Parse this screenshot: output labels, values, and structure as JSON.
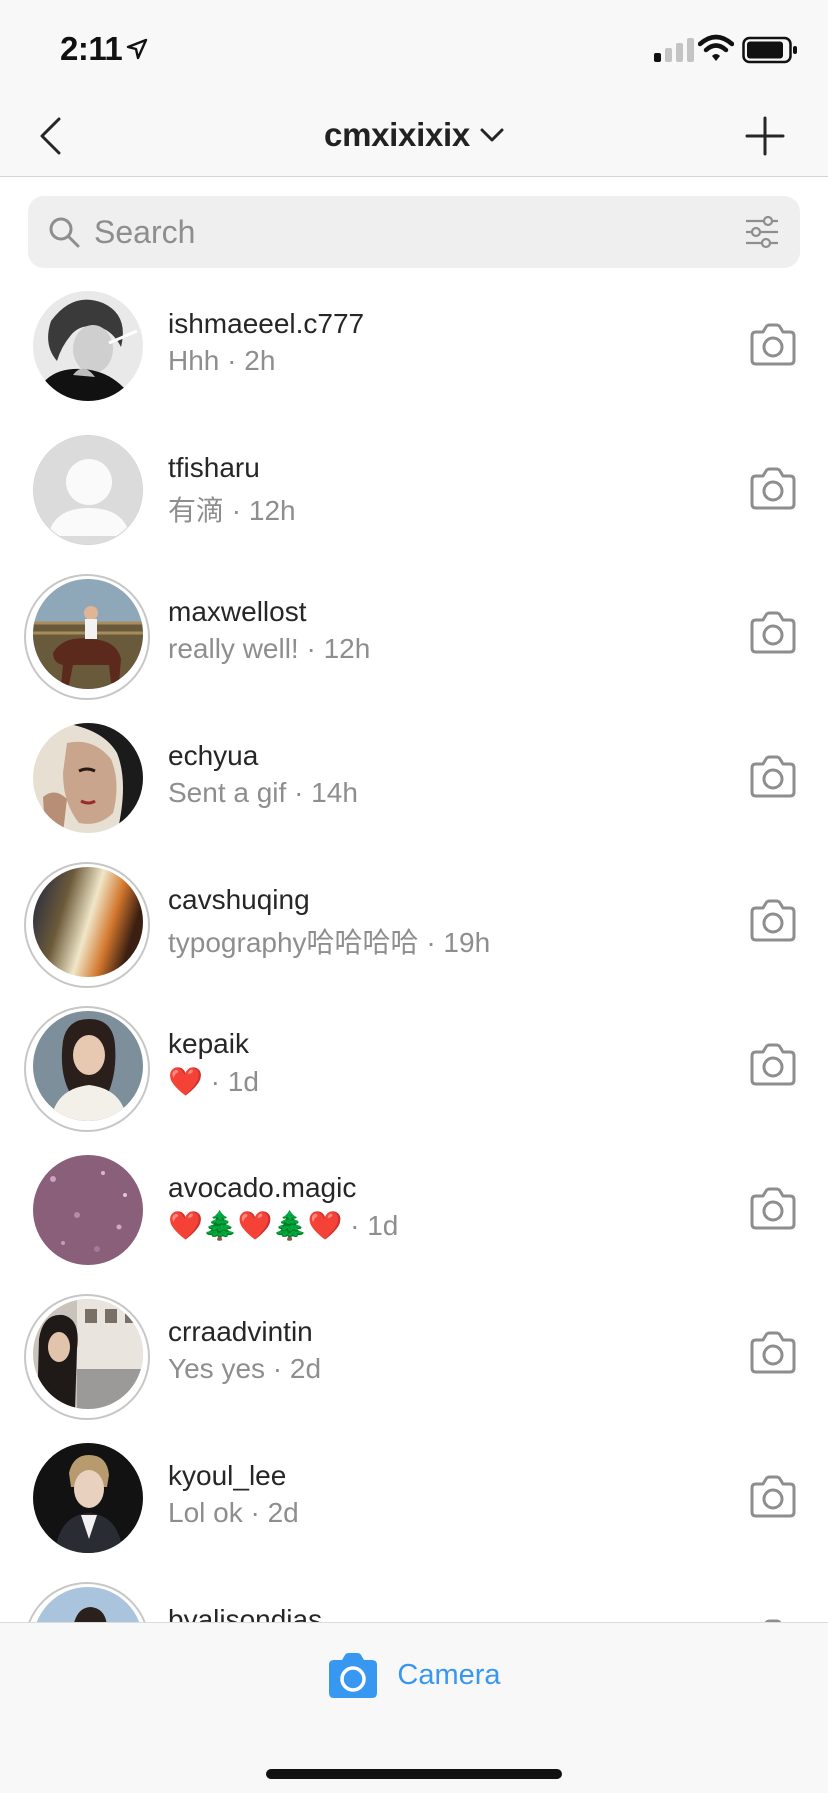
{
  "status_bar": {
    "time": "2:11"
  },
  "header": {
    "title": "cmxixixix"
  },
  "search": {
    "placeholder": "Search"
  },
  "threads": [
    {
      "username": "ishmaeeel.c777",
      "preview": "Hhh · 2h",
      "ring": false,
      "avatar": "bw-portrait"
    },
    {
      "username": "tfisharu",
      "preview": "有滴 · 12h",
      "ring": false,
      "avatar": "default-avatar"
    },
    {
      "username": "maxwellost",
      "preview": "really well! · 12h",
      "ring": true,
      "avatar": "horse-rider-photo"
    },
    {
      "username": "echyua",
      "preview": "Sent a gif · 14h",
      "ring": false,
      "avatar": "illustrated-woman"
    },
    {
      "username": "cavshuqing",
      "preview": "typography哈哈哈哈 · 19h",
      "ring": true,
      "avatar": "light-leak-photo"
    },
    {
      "username": "kepaik",
      "preview": "❤️ · 1d",
      "ring": true,
      "avatar": "woman-portrait"
    },
    {
      "username": "avocado.magic",
      "preview": "❤️🌲❤️🌲❤️ · 1d",
      "ring": false,
      "avatar": "purple-glitter"
    },
    {
      "username": "crraadvintin",
      "preview": "Yes yes · 2d",
      "ring": true,
      "avatar": "street-portrait"
    },
    {
      "username": "kyoul_lee",
      "preview": "Lol ok · 2d",
      "ring": false,
      "avatar": "man-portrait"
    },
    {
      "username": "byalisondias",
      "preview": "",
      "ring": true,
      "avatar": "sky-portrait"
    }
  ],
  "bottom_bar": {
    "camera_label": "Camera"
  },
  "colors": {
    "accent": "#3897f0",
    "secondary_text": "#8e8e8e",
    "background": "#f8f8f8"
  }
}
